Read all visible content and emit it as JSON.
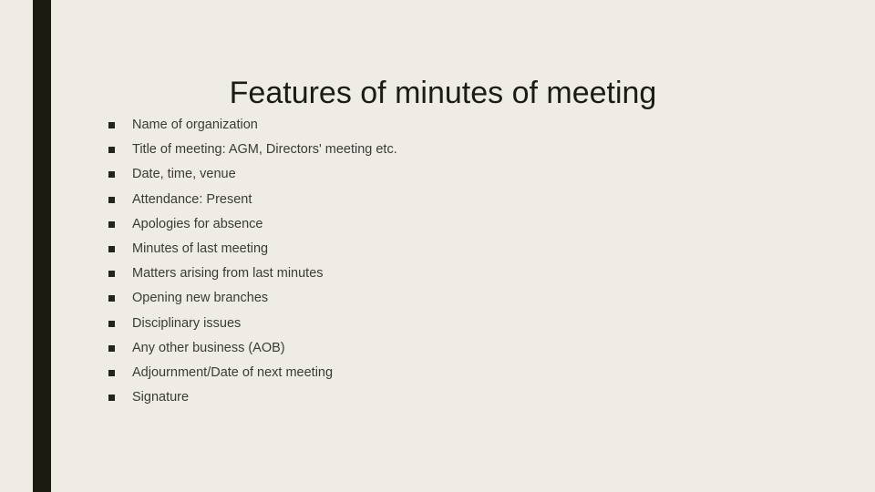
{
  "slide": {
    "title": "Features of minutes of meeting",
    "background_color": "#efece5",
    "accent_bar_color": "#1a1a11",
    "title_color": "#1c1c17",
    "body_text_color": "#3a3a36",
    "bullet_marker": "square",
    "items": [
      {
        "text": "Name of organization"
      },
      {
        "text": "Title of meeting: AGM, Directors' meeting etc."
      },
      {
        "text": "Date, time, venue"
      },
      {
        "text": "Attendance: Present"
      },
      {
        "text": "Apologies for absence"
      },
      {
        "text": "Minutes of last meeting"
      },
      {
        "text": "Matters arising from last minutes"
      },
      {
        "text": "Opening new branches"
      },
      {
        "text": "Disciplinary issues"
      },
      {
        "text": "Any other business (AOB)"
      },
      {
        "text": "Adjournment/Date of next meeting"
      },
      {
        "text": "Signature"
      }
    ]
  }
}
